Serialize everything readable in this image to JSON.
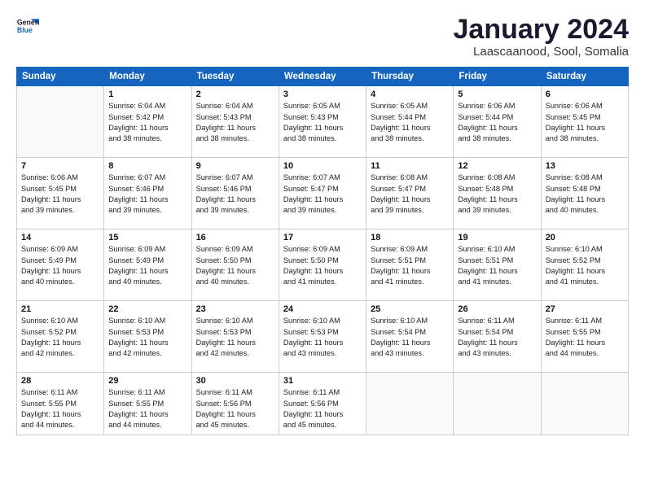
{
  "header": {
    "logo_line1": "General",
    "logo_line2": "Blue",
    "title": "January 2024",
    "subtitle": "Laascaanood, Sool, Somalia"
  },
  "columns": [
    "Sunday",
    "Monday",
    "Tuesday",
    "Wednesday",
    "Thursday",
    "Friday",
    "Saturday"
  ],
  "weeks": [
    [
      {
        "num": "",
        "lines": []
      },
      {
        "num": "1",
        "lines": [
          "Sunrise: 6:04 AM",
          "Sunset: 5:42 PM",
          "Daylight: 11 hours",
          "and 38 minutes."
        ]
      },
      {
        "num": "2",
        "lines": [
          "Sunrise: 6:04 AM",
          "Sunset: 5:43 PM",
          "Daylight: 11 hours",
          "and 38 minutes."
        ]
      },
      {
        "num": "3",
        "lines": [
          "Sunrise: 6:05 AM",
          "Sunset: 5:43 PM",
          "Daylight: 11 hours",
          "and 38 minutes."
        ]
      },
      {
        "num": "4",
        "lines": [
          "Sunrise: 6:05 AM",
          "Sunset: 5:44 PM",
          "Daylight: 11 hours",
          "and 38 minutes."
        ]
      },
      {
        "num": "5",
        "lines": [
          "Sunrise: 6:06 AM",
          "Sunset: 5:44 PM",
          "Daylight: 11 hours",
          "and 38 minutes."
        ]
      },
      {
        "num": "6",
        "lines": [
          "Sunrise: 6:06 AM",
          "Sunset: 5:45 PM",
          "Daylight: 11 hours",
          "and 38 minutes."
        ]
      }
    ],
    [
      {
        "num": "7",
        "lines": [
          "Sunrise: 6:06 AM",
          "Sunset: 5:45 PM",
          "Daylight: 11 hours",
          "and 39 minutes."
        ]
      },
      {
        "num": "8",
        "lines": [
          "Sunrise: 6:07 AM",
          "Sunset: 5:46 PM",
          "Daylight: 11 hours",
          "and 39 minutes."
        ]
      },
      {
        "num": "9",
        "lines": [
          "Sunrise: 6:07 AM",
          "Sunset: 5:46 PM",
          "Daylight: 11 hours",
          "and 39 minutes."
        ]
      },
      {
        "num": "10",
        "lines": [
          "Sunrise: 6:07 AM",
          "Sunset: 5:47 PM",
          "Daylight: 11 hours",
          "and 39 minutes."
        ]
      },
      {
        "num": "11",
        "lines": [
          "Sunrise: 6:08 AM",
          "Sunset: 5:47 PM",
          "Daylight: 11 hours",
          "and 39 minutes."
        ]
      },
      {
        "num": "12",
        "lines": [
          "Sunrise: 6:08 AM",
          "Sunset: 5:48 PM",
          "Daylight: 11 hours",
          "and 39 minutes."
        ]
      },
      {
        "num": "13",
        "lines": [
          "Sunrise: 6:08 AM",
          "Sunset: 5:48 PM",
          "Daylight: 11 hours",
          "and 40 minutes."
        ]
      }
    ],
    [
      {
        "num": "14",
        "lines": [
          "Sunrise: 6:09 AM",
          "Sunset: 5:49 PM",
          "Daylight: 11 hours",
          "and 40 minutes."
        ]
      },
      {
        "num": "15",
        "lines": [
          "Sunrise: 6:09 AM",
          "Sunset: 5:49 PM",
          "Daylight: 11 hours",
          "and 40 minutes."
        ]
      },
      {
        "num": "16",
        "lines": [
          "Sunrise: 6:09 AM",
          "Sunset: 5:50 PM",
          "Daylight: 11 hours",
          "and 40 minutes."
        ]
      },
      {
        "num": "17",
        "lines": [
          "Sunrise: 6:09 AM",
          "Sunset: 5:50 PM",
          "Daylight: 11 hours",
          "and 41 minutes."
        ]
      },
      {
        "num": "18",
        "lines": [
          "Sunrise: 6:09 AM",
          "Sunset: 5:51 PM",
          "Daylight: 11 hours",
          "and 41 minutes."
        ]
      },
      {
        "num": "19",
        "lines": [
          "Sunrise: 6:10 AM",
          "Sunset: 5:51 PM",
          "Daylight: 11 hours",
          "and 41 minutes."
        ]
      },
      {
        "num": "20",
        "lines": [
          "Sunrise: 6:10 AM",
          "Sunset: 5:52 PM",
          "Daylight: 11 hours",
          "and 41 minutes."
        ]
      }
    ],
    [
      {
        "num": "21",
        "lines": [
          "Sunrise: 6:10 AM",
          "Sunset: 5:52 PM",
          "Daylight: 11 hours",
          "and 42 minutes."
        ]
      },
      {
        "num": "22",
        "lines": [
          "Sunrise: 6:10 AM",
          "Sunset: 5:53 PM",
          "Daylight: 11 hours",
          "and 42 minutes."
        ]
      },
      {
        "num": "23",
        "lines": [
          "Sunrise: 6:10 AM",
          "Sunset: 5:53 PM",
          "Daylight: 11 hours",
          "and 42 minutes."
        ]
      },
      {
        "num": "24",
        "lines": [
          "Sunrise: 6:10 AM",
          "Sunset: 5:53 PM",
          "Daylight: 11 hours",
          "and 43 minutes."
        ]
      },
      {
        "num": "25",
        "lines": [
          "Sunrise: 6:10 AM",
          "Sunset: 5:54 PM",
          "Daylight: 11 hours",
          "and 43 minutes."
        ]
      },
      {
        "num": "26",
        "lines": [
          "Sunrise: 6:11 AM",
          "Sunset: 5:54 PM",
          "Daylight: 11 hours",
          "and 43 minutes."
        ]
      },
      {
        "num": "27",
        "lines": [
          "Sunrise: 6:11 AM",
          "Sunset: 5:55 PM",
          "Daylight: 11 hours",
          "and 44 minutes."
        ]
      }
    ],
    [
      {
        "num": "28",
        "lines": [
          "Sunrise: 6:11 AM",
          "Sunset: 5:55 PM",
          "Daylight: 11 hours",
          "and 44 minutes."
        ]
      },
      {
        "num": "29",
        "lines": [
          "Sunrise: 6:11 AM",
          "Sunset: 5:55 PM",
          "Daylight: 11 hours",
          "and 44 minutes."
        ]
      },
      {
        "num": "30",
        "lines": [
          "Sunrise: 6:11 AM",
          "Sunset: 5:56 PM",
          "Daylight: 11 hours",
          "and 45 minutes."
        ]
      },
      {
        "num": "31",
        "lines": [
          "Sunrise: 6:11 AM",
          "Sunset: 5:56 PM",
          "Daylight: 11 hours",
          "and 45 minutes."
        ]
      },
      {
        "num": "",
        "lines": []
      },
      {
        "num": "",
        "lines": []
      },
      {
        "num": "",
        "lines": []
      }
    ]
  ]
}
